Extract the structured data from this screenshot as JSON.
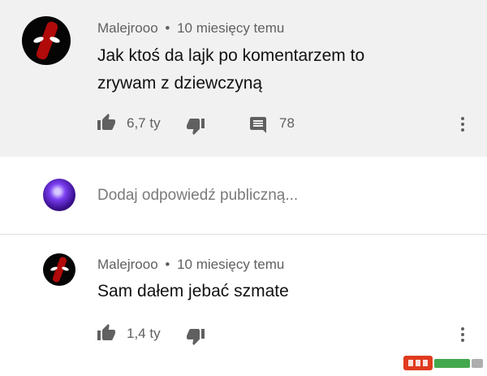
{
  "comments": [
    {
      "author": "Malejrooo",
      "time_ago": "10 miesięcy temu",
      "lines": [
        "Jak ktoś da lajk po komentarzem to",
        "zrywam z dziewczyną"
      ],
      "likes": "6,7 ty",
      "replies": "78"
    },
    {
      "author": "Malejrooo",
      "time_ago": "10 miesięcy temu",
      "lines": [
        "Sam dałem jebać szmate"
      ],
      "likes": "1,4 ty"
    }
  ],
  "reply_box": {
    "placeholder": "Dodaj odpowiedź publiczną..."
  },
  "separator": "•",
  "colors": {
    "highlight_bg": "#f1f1f1",
    "secondary_text": "#606060",
    "watermark_red": "#e03a1e",
    "watermark_green": "#2f9e3a"
  },
  "icons": [
    "thumbs-up-icon",
    "thumbs-down-icon",
    "comment-icon",
    "more-vert-icon",
    "avatar-deadpool",
    "avatar-purple"
  ]
}
